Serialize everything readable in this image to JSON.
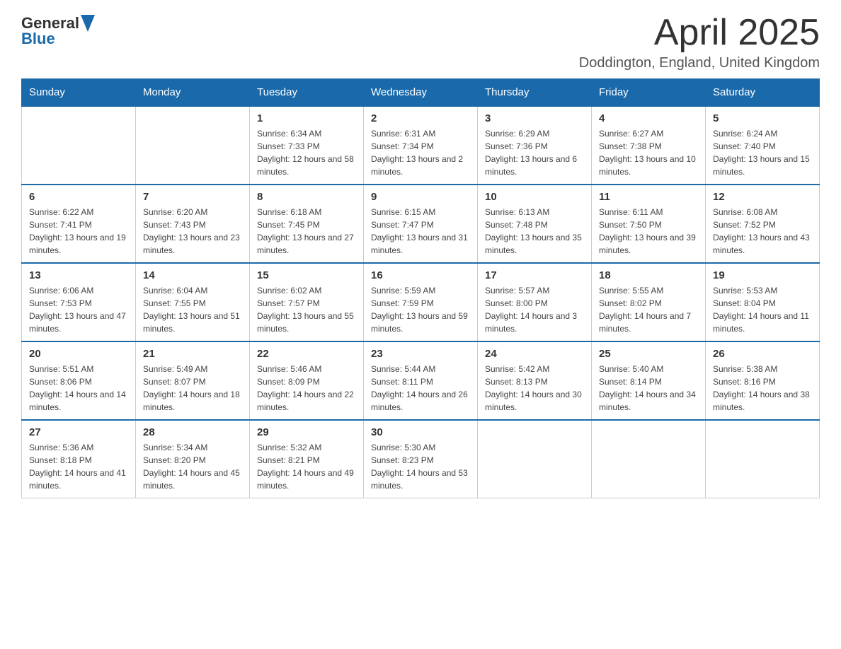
{
  "header": {
    "logo_general": "General",
    "logo_blue": "Blue",
    "month_title": "April 2025",
    "location": "Doddington, England, United Kingdom"
  },
  "weekdays": [
    "Sunday",
    "Monday",
    "Tuesday",
    "Wednesday",
    "Thursday",
    "Friday",
    "Saturday"
  ],
  "weeks": [
    [
      {
        "day": "",
        "sunrise": "",
        "sunset": "",
        "daylight": ""
      },
      {
        "day": "",
        "sunrise": "",
        "sunset": "",
        "daylight": ""
      },
      {
        "day": "1",
        "sunrise": "Sunrise: 6:34 AM",
        "sunset": "Sunset: 7:33 PM",
        "daylight": "Daylight: 12 hours and 58 minutes."
      },
      {
        "day": "2",
        "sunrise": "Sunrise: 6:31 AM",
        "sunset": "Sunset: 7:34 PM",
        "daylight": "Daylight: 13 hours and 2 minutes."
      },
      {
        "day": "3",
        "sunrise": "Sunrise: 6:29 AM",
        "sunset": "Sunset: 7:36 PM",
        "daylight": "Daylight: 13 hours and 6 minutes."
      },
      {
        "day": "4",
        "sunrise": "Sunrise: 6:27 AM",
        "sunset": "Sunset: 7:38 PM",
        "daylight": "Daylight: 13 hours and 10 minutes."
      },
      {
        "day": "5",
        "sunrise": "Sunrise: 6:24 AM",
        "sunset": "Sunset: 7:40 PM",
        "daylight": "Daylight: 13 hours and 15 minutes."
      }
    ],
    [
      {
        "day": "6",
        "sunrise": "Sunrise: 6:22 AM",
        "sunset": "Sunset: 7:41 PM",
        "daylight": "Daylight: 13 hours and 19 minutes."
      },
      {
        "day": "7",
        "sunrise": "Sunrise: 6:20 AM",
        "sunset": "Sunset: 7:43 PM",
        "daylight": "Daylight: 13 hours and 23 minutes."
      },
      {
        "day": "8",
        "sunrise": "Sunrise: 6:18 AM",
        "sunset": "Sunset: 7:45 PM",
        "daylight": "Daylight: 13 hours and 27 minutes."
      },
      {
        "day": "9",
        "sunrise": "Sunrise: 6:15 AM",
        "sunset": "Sunset: 7:47 PM",
        "daylight": "Daylight: 13 hours and 31 minutes."
      },
      {
        "day": "10",
        "sunrise": "Sunrise: 6:13 AM",
        "sunset": "Sunset: 7:48 PM",
        "daylight": "Daylight: 13 hours and 35 minutes."
      },
      {
        "day": "11",
        "sunrise": "Sunrise: 6:11 AM",
        "sunset": "Sunset: 7:50 PM",
        "daylight": "Daylight: 13 hours and 39 minutes."
      },
      {
        "day": "12",
        "sunrise": "Sunrise: 6:08 AM",
        "sunset": "Sunset: 7:52 PM",
        "daylight": "Daylight: 13 hours and 43 minutes."
      }
    ],
    [
      {
        "day": "13",
        "sunrise": "Sunrise: 6:06 AM",
        "sunset": "Sunset: 7:53 PM",
        "daylight": "Daylight: 13 hours and 47 minutes."
      },
      {
        "day": "14",
        "sunrise": "Sunrise: 6:04 AM",
        "sunset": "Sunset: 7:55 PM",
        "daylight": "Daylight: 13 hours and 51 minutes."
      },
      {
        "day": "15",
        "sunrise": "Sunrise: 6:02 AM",
        "sunset": "Sunset: 7:57 PM",
        "daylight": "Daylight: 13 hours and 55 minutes."
      },
      {
        "day": "16",
        "sunrise": "Sunrise: 5:59 AM",
        "sunset": "Sunset: 7:59 PM",
        "daylight": "Daylight: 13 hours and 59 minutes."
      },
      {
        "day": "17",
        "sunrise": "Sunrise: 5:57 AM",
        "sunset": "Sunset: 8:00 PM",
        "daylight": "Daylight: 14 hours and 3 minutes."
      },
      {
        "day": "18",
        "sunrise": "Sunrise: 5:55 AM",
        "sunset": "Sunset: 8:02 PM",
        "daylight": "Daylight: 14 hours and 7 minutes."
      },
      {
        "day": "19",
        "sunrise": "Sunrise: 5:53 AM",
        "sunset": "Sunset: 8:04 PM",
        "daylight": "Daylight: 14 hours and 11 minutes."
      }
    ],
    [
      {
        "day": "20",
        "sunrise": "Sunrise: 5:51 AM",
        "sunset": "Sunset: 8:06 PM",
        "daylight": "Daylight: 14 hours and 14 minutes."
      },
      {
        "day": "21",
        "sunrise": "Sunrise: 5:49 AM",
        "sunset": "Sunset: 8:07 PM",
        "daylight": "Daylight: 14 hours and 18 minutes."
      },
      {
        "day": "22",
        "sunrise": "Sunrise: 5:46 AM",
        "sunset": "Sunset: 8:09 PM",
        "daylight": "Daylight: 14 hours and 22 minutes."
      },
      {
        "day": "23",
        "sunrise": "Sunrise: 5:44 AM",
        "sunset": "Sunset: 8:11 PM",
        "daylight": "Daylight: 14 hours and 26 minutes."
      },
      {
        "day": "24",
        "sunrise": "Sunrise: 5:42 AM",
        "sunset": "Sunset: 8:13 PM",
        "daylight": "Daylight: 14 hours and 30 minutes."
      },
      {
        "day": "25",
        "sunrise": "Sunrise: 5:40 AM",
        "sunset": "Sunset: 8:14 PM",
        "daylight": "Daylight: 14 hours and 34 minutes."
      },
      {
        "day": "26",
        "sunrise": "Sunrise: 5:38 AM",
        "sunset": "Sunset: 8:16 PM",
        "daylight": "Daylight: 14 hours and 38 minutes."
      }
    ],
    [
      {
        "day": "27",
        "sunrise": "Sunrise: 5:36 AM",
        "sunset": "Sunset: 8:18 PM",
        "daylight": "Daylight: 14 hours and 41 minutes."
      },
      {
        "day": "28",
        "sunrise": "Sunrise: 5:34 AM",
        "sunset": "Sunset: 8:20 PM",
        "daylight": "Daylight: 14 hours and 45 minutes."
      },
      {
        "day": "29",
        "sunrise": "Sunrise: 5:32 AM",
        "sunset": "Sunset: 8:21 PM",
        "daylight": "Daylight: 14 hours and 49 minutes."
      },
      {
        "day": "30",
        "sunrise": "Sunrise: 5:30 AM",
        "sunset": "Sunset: 8:23 PM",
        "daylight": "Daylight: 14 hours and 53 minutes."
      },
      {
        "day": "",
        "sunrise": "",
        "sunset": "",
        "daylight": ""
      },
      {
        "day": "",
        "sunrise": "",
        "sunset": "",
        "daylight": ""
      },
      {
        "day": "",
        "sunrise": "",
        "sunset": "",
        "daylight": ""
      }
    ]
  ]
}
